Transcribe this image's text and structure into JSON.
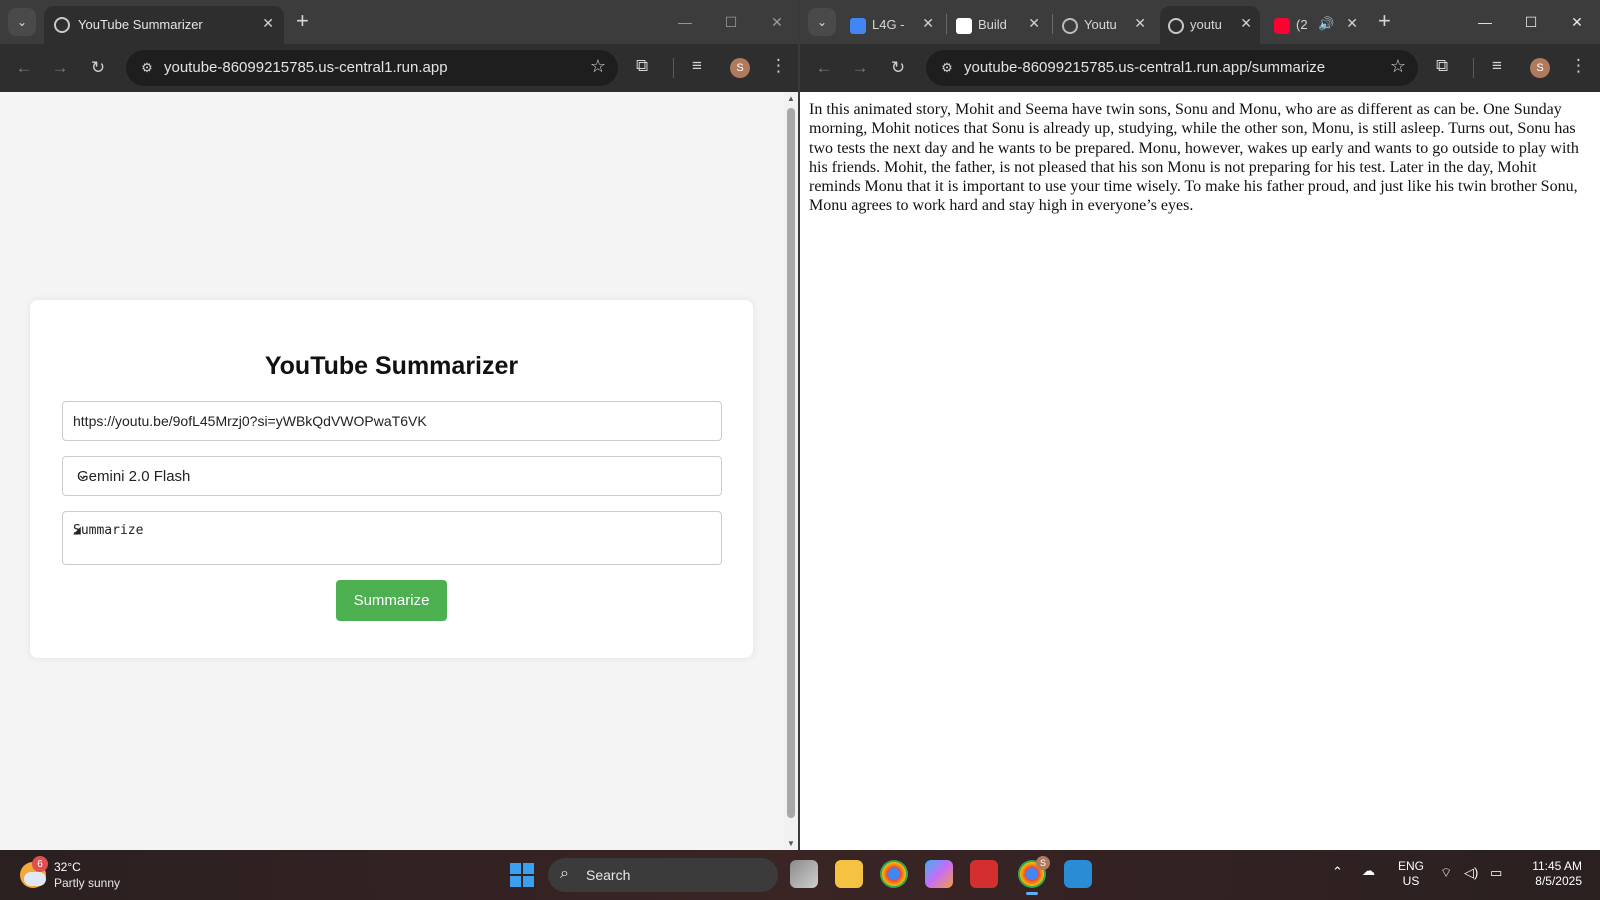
{
  "left_window": {
    "tab_title": "YouTube Summarizer",
    "address": "youtube-86099215785.us-central1.run.app",
    "profile_initial": "S",
    "page": {
      "title": "YouTube Summarizer",
      "url_value": "https://youtu.be/9ofL45Mrzj0?si=yWBkQdVWOPwaT6VK",
      "model_selected": "Gemini 2.0 Flash",
      "prompt_value": "Summarize",
      "submit_label": "Summarize",
      "accent_color": "#4caf50"
    }
  },
  "right_window": {
    "tabs": [
      {
        "title": "L4G -",
        "icon": "docs-icon",
        "active": false
      },
      {
        "title": "Build",
        "icon": "ai-studio-icon",
        "active": false
      },
      {
        "title": "Youtu",
        "icon": "settings-favicon-icon",
        "active": false
      },
      {
        "title": "youtu",
        "icon": "globe-icon",
        "active": true
      },
      {
        "title": "(2",
        "icon": "youtube-icon",
        "active": false
      }
    ],
    "address": "youtube-86099215785.us-central1.run.app/summarize",
    "profile_initial": "S",
    "summary_text": "In this animated story, Mohit and Seema have twin sons, Sonu and Monu, who are as different as can be. One Sunday morning, Mohit notices that Sonu is already up, studying, while the other son, Monu, is still asleep. Turns out, Sonu has two tests the next day and he wants to be prepared. Monu, however, wakes up early and wants to go outside to play with his friends. Mohit, the father, is not pleased that his son Monu is not preparing for his test. Later in the day, Mohit reminds Monu that it is important to use your time wisely. To make his father proud, and just like his twin brother Sonu, Monu agrees to work hard and stay high in everyone’s eyes."
  },
  "taskbar": {
    "weather_badge": "6",
    "weather_temp": "32°C",
    "weather_condition": "Partly sunny",
    "search_label": "Search",
    "chrome_badge": "S",
    "lang_line1": "ENG",
    "lang_line2": "US",
    "time": "11:45 AM",
    "date": "8/5/2025"
  }
}
